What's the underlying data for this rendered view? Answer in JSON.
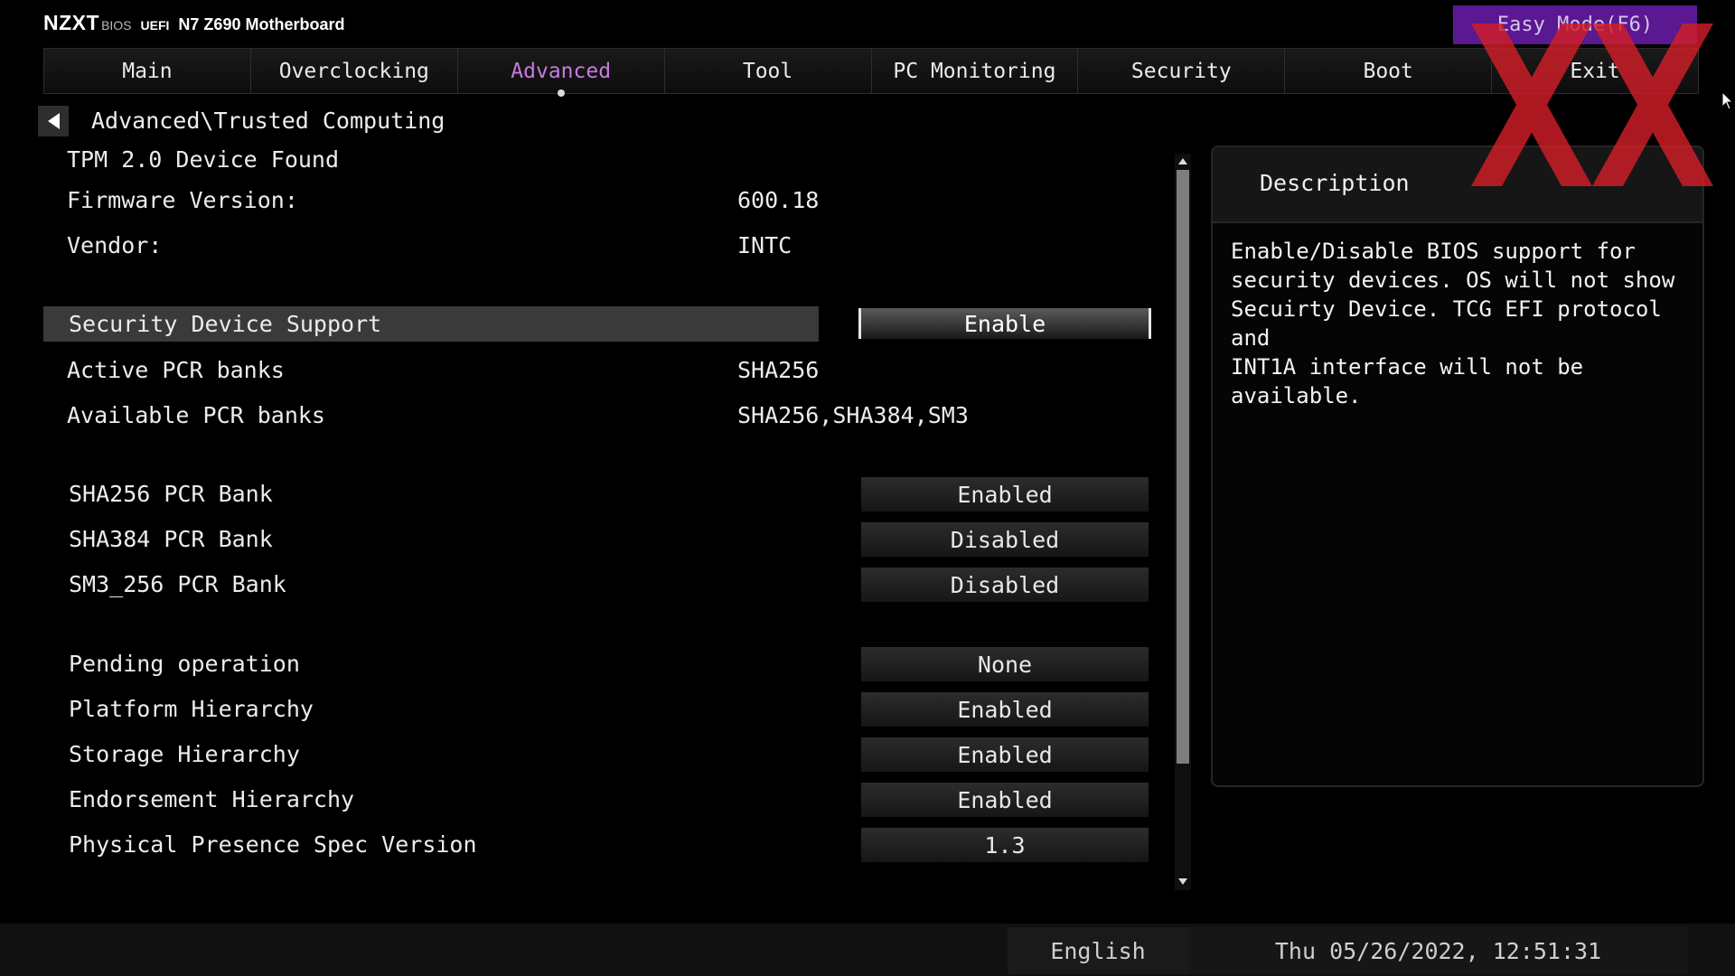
{
  "header": {
    "brand": "NZXT",
    "bios": "BIOS",
    "uefi": "UEFI",
    "model": "N7 Z690 Motherboard",
    "easy_mode": "Easy Mode(F6)"
  },
  "tabs": [
    {
      "label": "Main",
      "active": false
    },
    {
      "label": "Overclocking",
      "active": false
    },
    {
      "label": "Advanced",
      "active": true
    },
    {
      "label": "Tool",
      "active": false
    },
    {
      "label": "PC Monitoring",
      "active": false
    },
    {
      "label": "Security",
      "active": false
    },
    {
      "label": "Boot",
      "active": false
    },
    {
      "label": "Exit",
      "active": false
    }
  ],
  "breadcrumb": "Advanced\\Trusted Computing",
  "info": {
    "tpm_found": "TPM 2.0 Device Found",
    "firmware_label": "Firmware Version:",
    "firmware_value": "600.18",
    "vendor_label": "Vendor:",
    "vendor_value": "INTC"
  },
  "settings": {
    "security_device_support": {
      "label": "Security Device Support",
      "value": "Enable"
    },
    "active_pcr_banks": {
      "label": "Active PCR banks",
      "value": "SHA256"
    },
    "available_pcr_banks": {
      "label": "Available PCR banks",
      "value": "SHA256,SHA384,SM3"
    },
    "sha256_pcr_bank": {
      "label": "SHA256 PCR Bank",
      "value": "Enabled"
    },
    "sha384_pcr_bank": {
      "label": "SHA384 PCR Bank",
      "value": "Disabled"
    },
    "sm3_256_pcr_bank": {
      "label": "SM3_256 PCR Bank",
      "value": "Disabled"
    },
    "pending_operation": {
      "label": "Pending operation",
      "value": "None"
    },
    "platform_hierarchy": {
      "label": "Platform Hierarchy",
      "value": "Enabled"
    },
    "storage_hierarchy": {
      "label": "Storage Hierarchy",
      "value": "Enabled"
    },
    "endorsement_hierarchy": {
      "label": "Endorsement Hierarchy",
      "value": "Enabled"
    },
    "physical_presence_spec_version": {
      "label": "Physical Presence Spec Version",
      "value": "1.3"
    }
  },
  "description": {
    "title": "Description",
    "text": "Enable/Disable BIOS support for\nsecurity devices. OS will not show\nSecuirty Device. TCG EFI protocol and\nINT1A interface will not be available."
  },
  "footer": {
    "language": "English",
    "datetime": "Thu 05/26/2022, 12:51:31"
  },
  "colors": {
    "accent": "#c77be0",
    "easy_mode_bg": "#5a1891",
    "watermark": "#d21e28"
  },
  "icons": {
    "back": "back-arrow-icon",
    "scroll_up": "scroll-up-arrow-icon",
    "scroll_down": "scroll-down-arrow-icon",
    "cursor": "mouse-pointer-icon"
  }
}
